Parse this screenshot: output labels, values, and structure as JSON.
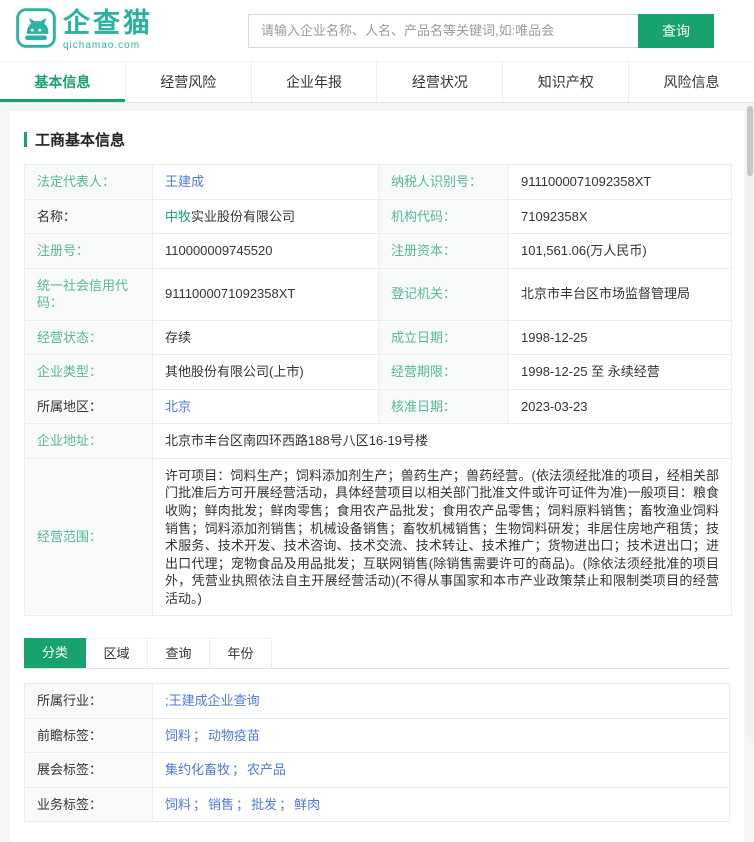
{
  "colors": {
    "brand_green": "#17A26E",
    "logo_teal": "#2AB3A0",
    "link_blue": "#5179DD",
    "label_green": "#57B892"
  },
  "header": {
    "logo_text": "企查猫",
    "logo_domain": "qichamao.com",
    "search_placeholder": "请输入企业名称、人名、产品名等关键词,如:唯品会",
    "search_button": "查询"
  },
  "nav": {
    "labels": [
      "基本信息",
      "经营风险",
      "企业年报",
      "经营状况",
      "知识产权",
      "风险信息"
    ]
  },
  "section_title": "工商基本信息",
  "info": {
    "r1": {
      "l1": "法定代表人：",
      "v1": "王建成",
      "l2": "纳税人识别号：",
      "v2": "9111000071092358XT"
    },
    "r2": {
      "l1": "名称：",
      "v1_highlight": "中牧",
      "v1_rest": "实业股份有限公司",
      "l2": "机构代码：",
      "v2": "71092358X"
    },
    "r3": {
      "l1": "注册号：",
      "v1": "110000009745520",
      "l2": "注册资本：",
      "v2": "101,561.06(万人民币)"
    },
    "r4": {
      "l1": "统一社会信用代码：",
      "v1": "9111000071092358XT",
      "l2": "登记机关：",
      "v2": "北京市丰台区市场监督管理局"
    },
    "r5": {
      "l1": "经营状态：",
      "v1": "存续",
      "l2": "成立日期：",
      "v2": "1998-12-25"
    },
    "r6": {
      "l1": "企业类型：",
      "v1": "其他股份有限公司(上市)",
      "l2": "经营期限：",
      "v2": "1998-12-25 至 永续经营"
    },
    "r7": {
      "l1": "所属地区：",
      "v1": "北京",
      "l2": "核准日期：",
      "v2": "2023-03-23"
    },
    "r8": {
      "l1": "企业地址：",
      "v1": "北京市丰台区南四环西路188号八区16-19号楼"
    },
    "r9": {
      "l1": "经营范围：",
      "v1": "许可项目：饲料生产；饲料添加剂生产；兽药生产；兽药经营。(依法须经批准的项目，经相关部门批准后方可开展经营活动，具体经营项目以相关部门批准文件或许可证件为准)一般项目：粮食收购；鲜肉批发；鲜肉零售；食用农产品批发；食用农产品零售；饲料原料销售；畜牧渔业饲料销售；饲料添加剂销售；机械设备销售；畜牧机械销售；生物饲料研发；非居住房地产租赁；技术服务、技术开发、技术咨询、技术交流、技术转让、技术推广；货物进出口；技术进出口；进出口代理；宠物食品及用品批发；互联网销售(除销售需要许可的商品)。(除依法须经批准的项目外，凭营业执照依法自主开展经营活动)(不得从事国家和本市产业政策禁止和限制类项目的经营活动。)"
    }
  },
  "filters": {
    "labels": [
      "分类",
      "区域",
      "查询",
      "年份"
    ]
  },
  "tags": {
    "separator": "；",
    "industry": {
      "label": "所属行业：",
      "link": ";王建成企业查询"
    },
    "foresight": {
      "label": "前瞻标签：",
      "links": [
        "饲料",
        "动物疫苗"
      ]
    },
    "expo": {
      "label": "展会标签：",
      "links": [
        "集约化畜牧",
        "农产品"
      ]
    },
    "business": {
      "label": "业务标签：",
      "links": [
        "饲料",
        "销售",
        "批发",
        "鲜肉"
      ]
    }
  }
}
